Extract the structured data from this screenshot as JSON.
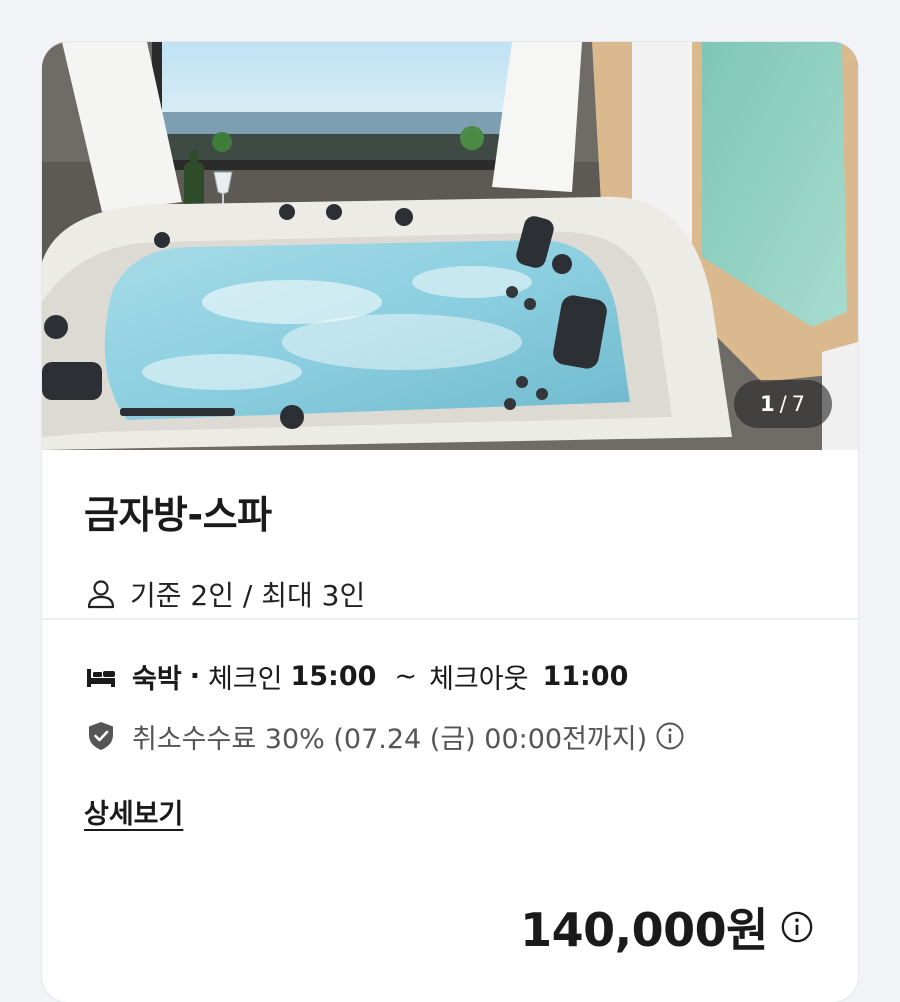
{
  "room": {
    "image_counter": {
      "current": "1",
      "separator": "/",
      "total": "7"
    },
    "name": "금자방-스파",
    "capacity": "기준 2인 / 최대 3인"
  },
  "stay": {
    "type": "숙박",
    "separator": "·",
    "checkin_label": "체크인",
    "checkin_time": "15:00",
    "tilde": "~",
    "checkout_label": "체크아웃",
    "checkout_time": "11:00",
    "cancellation": "취소수수료 30% (07.24 (금) 00:00전까지)",
    "details_link": "상세보기"
  },
  "price": {
    "amount": "140,000원"
  },
  "icons": {
    "capacity": "person-icon",
    "stay": "bed-icon",
    "cancellation": "shield-check-icon",
    "info": "info-circle-icon"
  },
  "colors": {
    "background": "#f2f3f7",
    "card": "#ffffff",
    "text": "#1a1a1a",
    "muted": "#555555",
    "counter_bg": "#282828"
  }
}
